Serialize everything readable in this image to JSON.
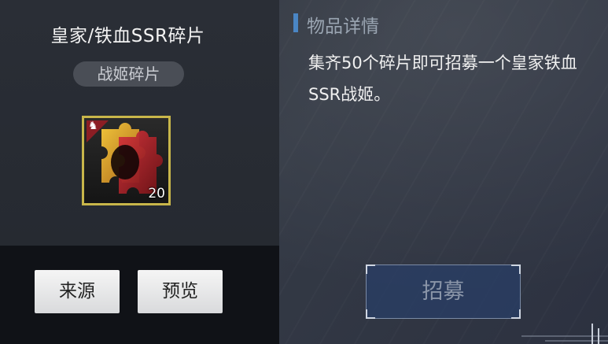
{
  "item": {
    "title": "皇家/铁血SSR碎片",
    "tag": "战姬碎片",
    "icon": "puzzle-fragment-icon",
    "count": "20",
    "frame_color": "#c8b64a"
  },
  "buttons": {
    "source_label": "来源",
    "preview_label": "预览",
    "recruit_label": "招募"
  },
  "details": {
    "header": "物品详情",
    "description": "集齐50个碎片即可招募一个皇家铁血SSR战姬。"
  },
  "colors": {
    "accent": "#4a86c4",
    "recruit_bg": "#283e68"
  }
}
